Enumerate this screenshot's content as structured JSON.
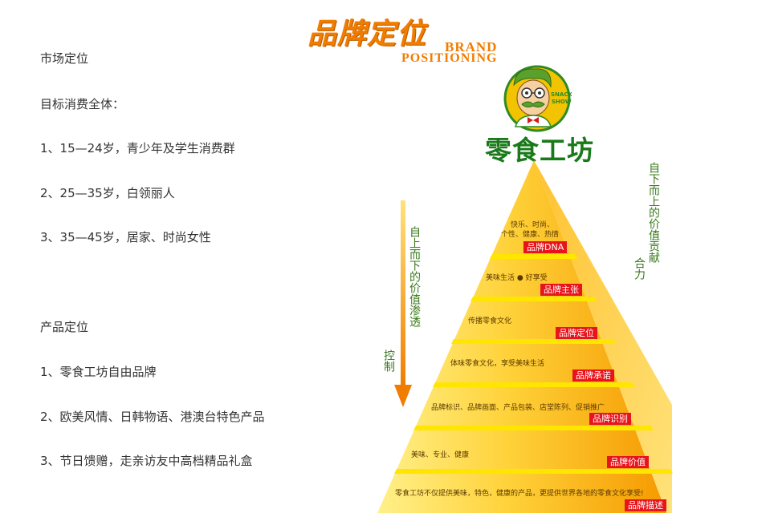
{
  "header": {
    "title_cn": "品牌定位",
    "title_en_line1": "BRAND",
    "title_en_line2": "POSITIONING"
  },
  "logo": {
    "badge_line1": "SNACK",
    "badge_line2": "SHOW",
    "brand_name": "零食工坊"
  },
  "market": {
    "heading": "市场定位",
    "sub_heading": "目标消费全体：",
    "items": [
      "1、15—24岁，青少年及学生消费群",
      "2、25—35岁，白领丽人",
      "3、35—45岁，居家、时尚女性"
    ]
  },
  "product": {
    "heading": "产品定位",
    "items": [
      "1、零食工坊自由品牌",
      "2、欧美风情、日韩物语、港澳台特色产品",
      "3、节日馈赠，走亲访友中高档精品礼盒"
    ]
  },
  "pyramid": {
    "levels": [
      {
        "desc_lines": [
          "快乐、时尚、",
          "个性、健康、热情"
        ],
        "tag": "品牌DNA"
      },
      {
        "desc_lines": [
          "美味生活 ● 好享受"
        ],
        "tag": "品牌主张"
      },
      {
        "desc_lines": [
          "传播零食文化"
        ],
        "tag": "品牌定位"
      },
      {
        "desc_lines": [
          "体味零食文化，享受美味生活"
        ],
        "tag": "品牌承诺"
      },
      {
        "desc_lines": [
          "品牌标识、品牌画面、产品包装、店堂陈列、促销推广"
        ],
        "tag": "品牌识别"
      },
      {
        "desc_lines": [
          "美味、专业、健康"
        ],
        "tag": "品牌价值"
      },
      {
        "desc_lines": [
          "零食工坊不仅提供美味，特色，健康的产品，更提供世界各地的零食文化享受!"
        ],
        "tag": "品牌描述"
      }
    ]
  },
  "side_labels": {
    "left_main": "自上而下的价值渗透",
    "left_sub": "控制",
    "right_main": "自下而上的价值贡献",
    "right_sub": "合力"
  },
  "colors": {
    "accent_orange": "#f07c00",
    "brand_green": "#1a7a1a",
    "tag_red": "#e8141c",
    "pyramid_yellow": "#ffd84a"
  }
}
